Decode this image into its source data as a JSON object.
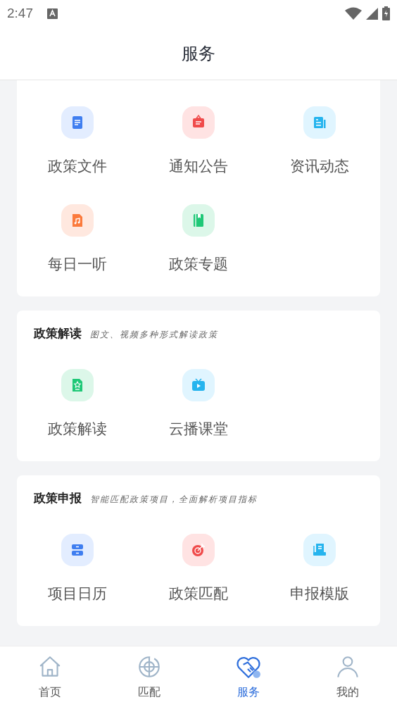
{
  "status_bar": {
    "time": "2:47"
  },
  "header": {
    "title": "服务"
  },
  "sections": [
    {
      "items": [
        {
          "label": "政策文件"
        },
        {
          "label": "通知公告"
        },
        {
          "label": "资讯动态"
        },
        {
          "label": "每日一听"
        },
        {
          "label": "政策专题"
        }
      ]
    },
    {
      "title": "政策解读",
      "subtitle": "图文、视频多种形式解读政策",
      "items": [
        {
          "label": "政策解读"
        },
        {
          "label": "云播课堂"
        }
      ]
    },
    {
      "title": "政策申报",
      "subtitle": "智能匹配政策项目，全面解析项目指标",
      "items": [
        {
          "label": "项目日历"
        },
        {
          "label": "政策匹配"
        },
        {
          "label": "申报模版"
        }
      ]
    }
  ],
  "tab_bar": [
    {
      "label": "首页",
      "selected": false
    },
    {
      "label": "匹配",
      "selected": false
    },
    {
      "label": "服务",
      "selected": true
    },
    {
      "label": "我的",
      "selected": false
    }
  ]
}
